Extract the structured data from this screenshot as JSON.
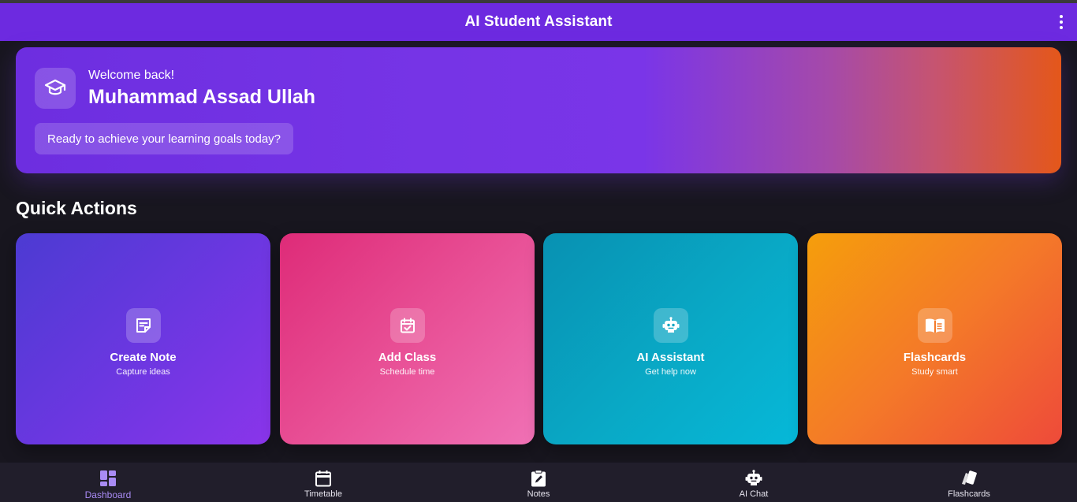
{
  "app": {
    "title": "AI Student Assistant"
  },
  "welcome": {
    "greeting": "Welcome back!",
    "name": "Muhammad Assad Ullah",
    "tagline": "Ready to achieve your learning goals today?"
  },
  "quick_actions": {
    "title": "Quick Actions",
    "items": [
      {
        "title": "Create Note",
        "subtitle": "Capture ideas",
        "icon": "note-icon"
      },
      {
        "title": "Add Class",
        "subtitle": "Schedule time",
        "icon": "calendar-check-icon"
      },
      {
        "title": "AI Assistant",
        "subtitle": "Get help now",
        "icon": "robot-icon"
      },
      {
        "title": "Flashcards",
        "subtitle": "Study smart",
        "icon": "book-open-icon"
      }
    ]
  },
  "nav": {
    "items": [
      {
        "label": "Dashboard",
        "icon": "dashboard-icon",
        "active": true
      },
      {
        "label": "Timetable",
        "icon": "calendar-icon",
        "active": false
      },
      {
        "label": "Notes",
        "icon": "clipboard-edit-icon",
        "active": false
      },
      {
        "label": "AI Chat",
        "icon": "robot-icon",
        "active": false
      },
      {
        "label": "Flashcards",
        "icon": "cards-icon",
        "active": false
      }
    ]
  },
  "colors": {
    "appbar": "#6d2ae0",
    "background": "#18161f",
    "nav_active": "#a98bf5"
  }
}
